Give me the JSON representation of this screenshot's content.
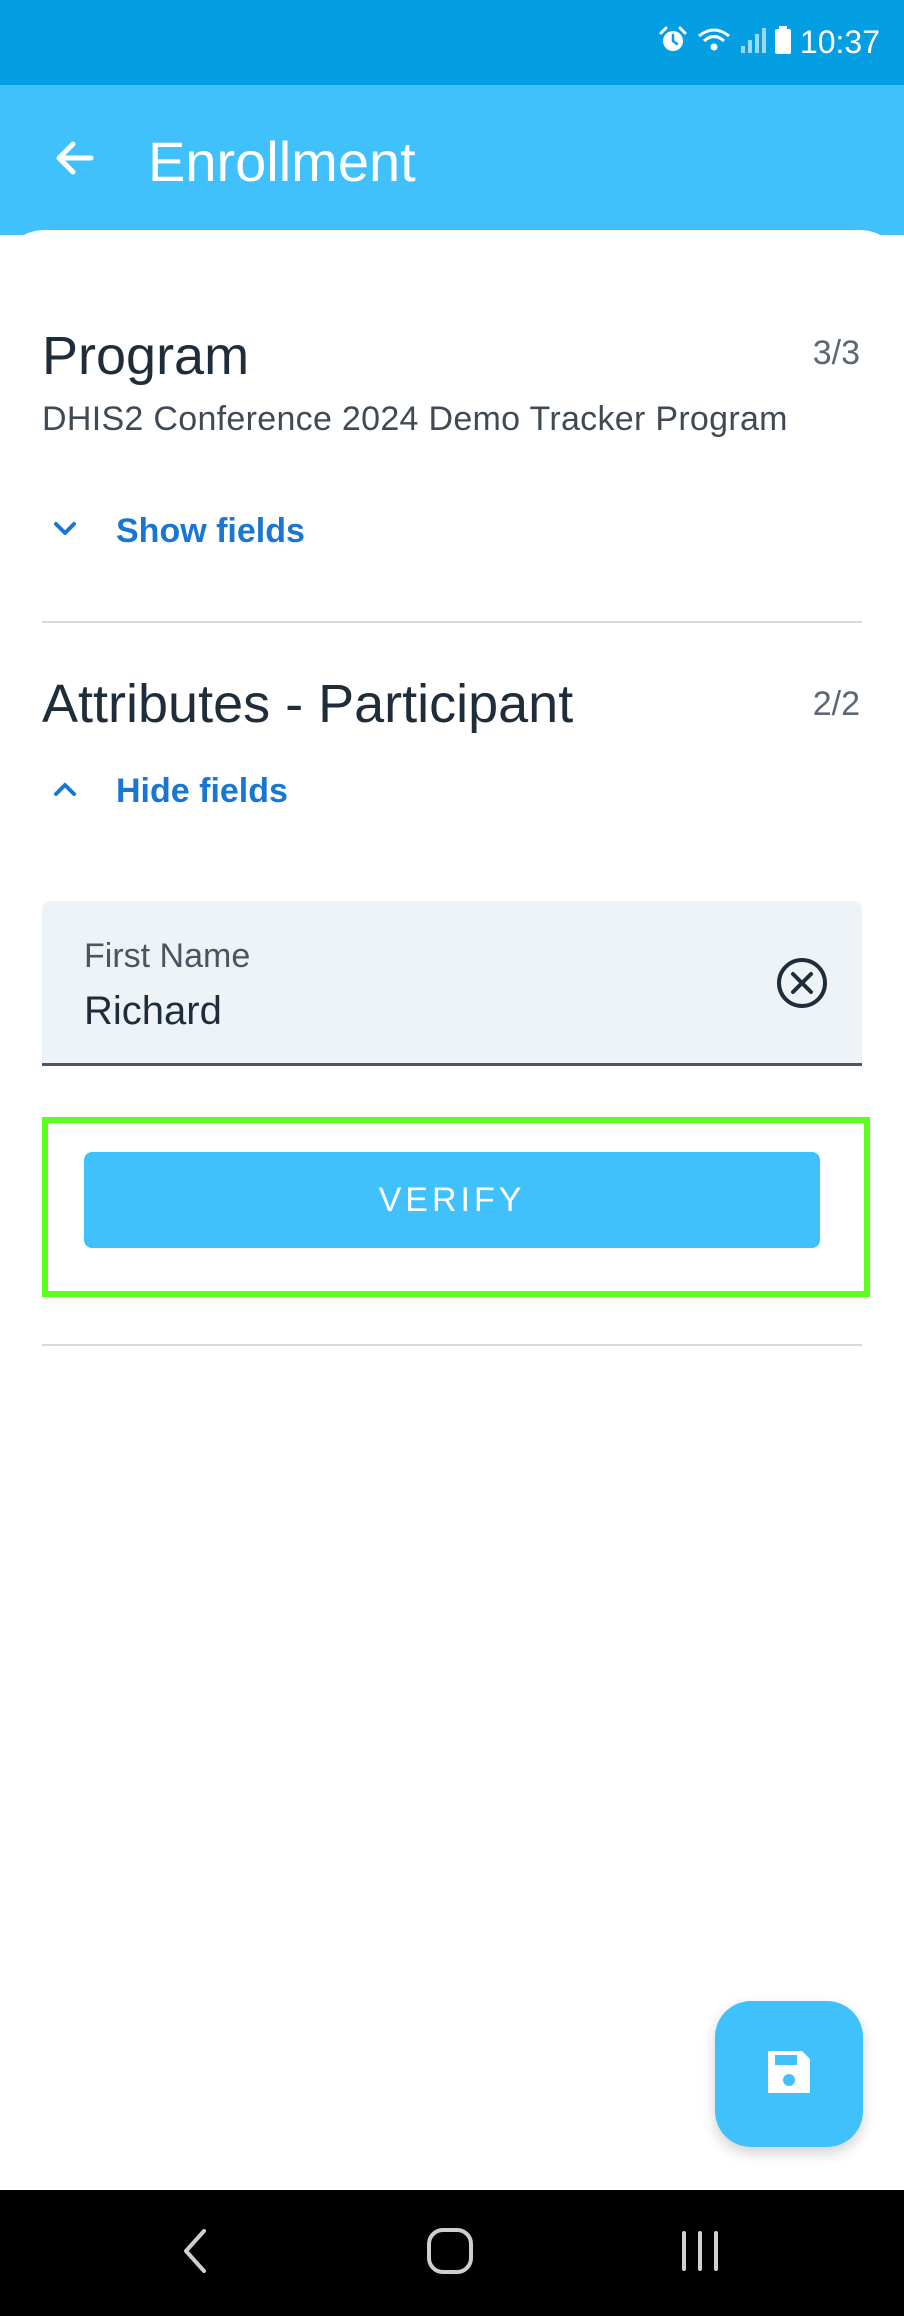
{
  "status_bar": {
    "time": "10:37",
    "icons": [
      "alarm-icon",
      "wifi-icon",
      "signal-icon",
      "battery-icon"
    ]
  },
  "app_bar": {
    "title": "Enrollment",
    "back_icon": "arrow-back-icon"
  },
  "sections": [
    {
      "title": "Program",
      "count": "3/3",
      "description": "DHIS2 Conference 2024 Demo Tracker Program",
      "toggle_label": "Show fields",
      "toggle_icon": "chevron-down-icon"
    },
    {
      "title": "Attributes - Participant",
      "count": "2/2",
      "toggle_label": "Hide fields",
      "toggle_icon": "chevron-up-icon",
      "fields": [
        {
          "label": "First Name",
          "value": "Richard",
          "clear_icon": "clear-circle-icon"
        }
      ],
      "verify_label": "VERIFY"
    }
  ],
  "fab": {
    "icon": "save-icon"
  },
  "nav_bar": {
    "icons": [
      "nav-back-icon",
      "nav-home-icon",
      "nav-recents-icon"
    ]
  },
  "colors": {
    "status_bar": "#049ee3",
    "app_bar": "#40c1fc",
    "accent_link": "#1977d3",
    "field_bg": "#eef3f7",
    "highlight": "#5dff1f"
  }
}
